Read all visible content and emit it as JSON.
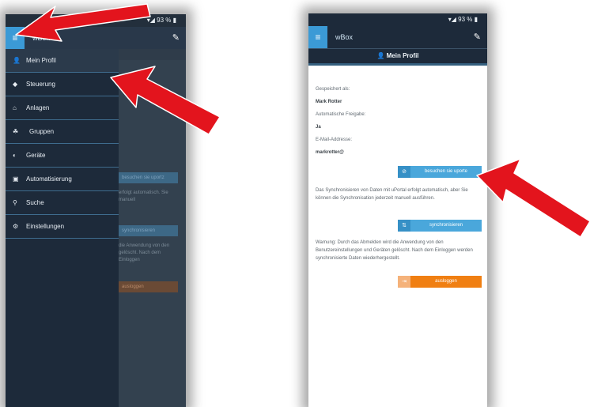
{
  "left_phone": {
    "status": "▾◢ 93 % ▮",
    "app_title": "wBox",
    "menu_icon": "hamburger-icon",
    "edit_icon": "pencil-icon",
    "drawer_items": [
      {
        "icon": "person-icon",
        "glyph": "👤",
        "label": "Mein Profil"
      },
      {
        "icon": "control-icon",
        "glyph": "◆",
        "label": "Steuerung"
      },
      {
        "icon": "home-icon",
        "glyph": "⌂",
        "label": "Anlagen"
      },
      {
        "icon": "group-icon",
        "glyph": "☘",
        "label": "Gruppen"
      },
      {
        "icon": "device-icon",
        "glyph": "◐",
        "label": "Geräte"
      },
      {
        "icon": "automation-icon",
        "glyph": "▣",
        "label": "Automatisierung"
      },
      {
        "icon": "search-icon",
        "glyph": "⚲",
        "label": "Suche"
      },
      {
        "icon": "gear-icon",
        "glyph": "⚙",
        "label": "Einstellungen"
      }
    ],
    "bg_button_1": "besuchen sie uportz",
    "bg_text_1": "erfolgt automatisch. Sie manuell",
    "bg_button_2": "synchronisieren",
    "bg_text_2": "die Anwendung von den gelöscht. Nach dem Einloggen",
    "bg_button_3": "ausloggen"
  },
  "right_phone": {
    "status": "▾◢ 93 % ▮",
    "app_title": "wBox",
    "menu_icon": "hamburger-icon",
    "edit_icon": "pencil-icon",
    "page_title": "Mein Profil",
    "saved_as_label": "Gespeichert als:",
    "saved_as_value": "Mark Rotter",
    "auto_release_label": "Automatische Freigabe:",
    "auto_release_value": "Ja",
    "email_label": "E-Mail-Addresse:",
    "email_value": "markrotter@",
    "visit_button": "besuchen sie uporte",
    "sync_text": "Das Synchronisieren von Daten mit uPortal erfolgt automatisch, aber Sie können die Synchronisation jederzeit manuell ausführen.",
    "sync_button": "synchronisieren",
    "warning_text": "Warnung: Durch das Abmelden wird die Anwendung von den Benutzereinstellungen und Geräten gelöscht. Nach dem Einloggen werden synchronisierte Daten wiederhergestellt.",
    "logout_button": "ausloggen"
  },
  "colors": {
    "annotation_arrow": "#e3141d",
    "accent_blue": "#4aa7db",
    "logout_orange": "#f07f12",
    "drawer_bg": "#1d2a3a"
  }
}
